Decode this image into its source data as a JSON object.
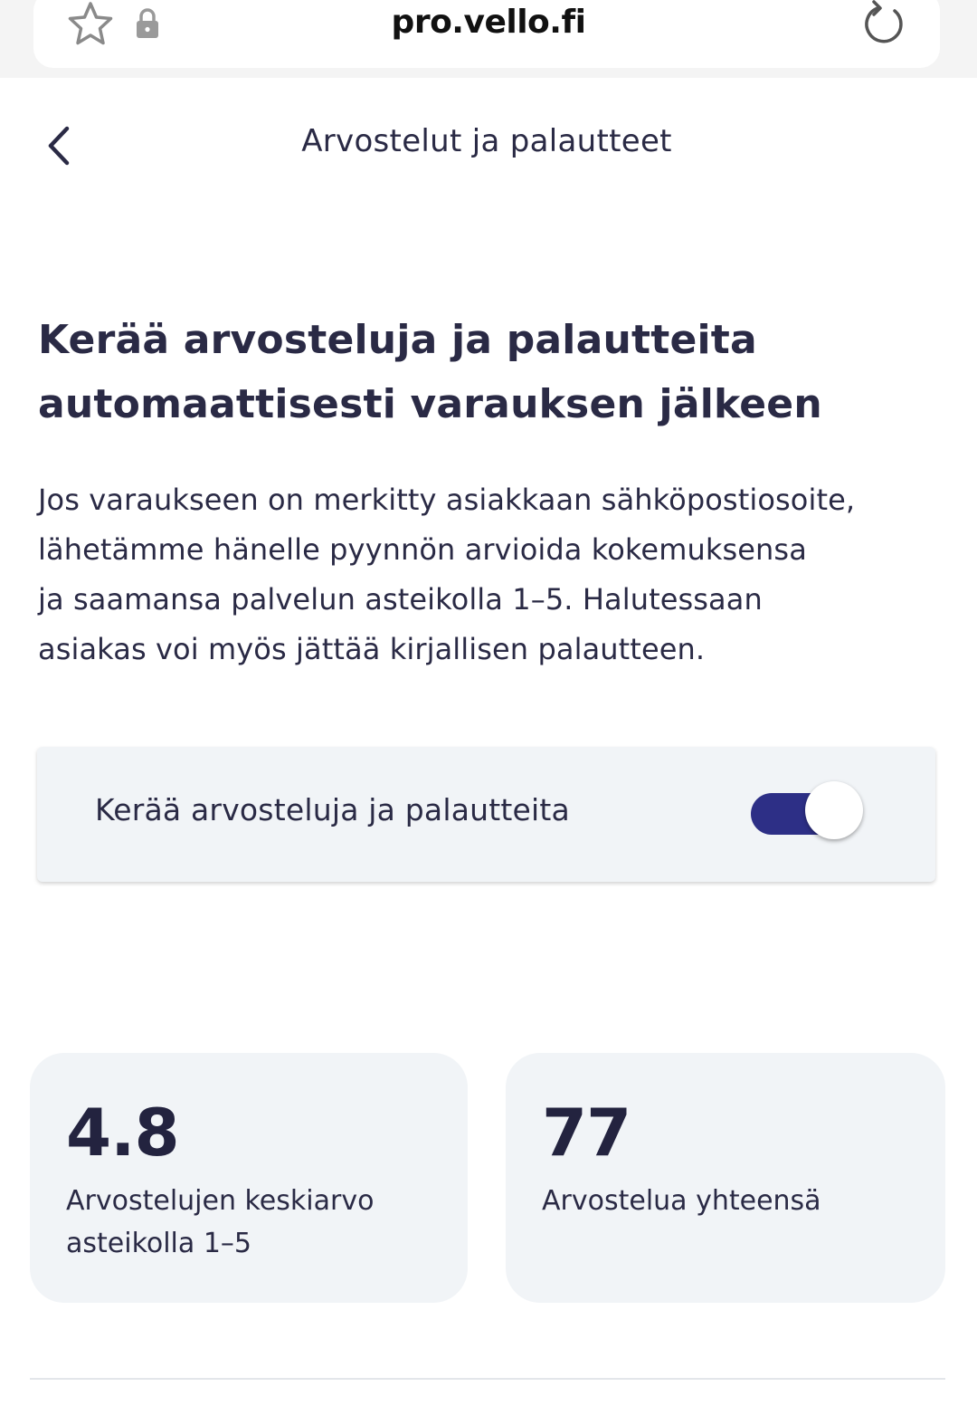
{
  "browser": {
    "url": "pro.vello.fi",
    "icons": [
      "star-icon",
      "lock-icon",
      "reload-icon"
    ]
  },
  "header": {
    "title": "Arvostelut ja palautteet",
    "back_icon": "chevron-left-icon"
  },
  "intro": {
    "headline_line1": "Kerää arvosteluja ja palautteita",
    "headline_line2": "automaattisesti varauksen jälkeen",
    "description_lines": [
      "Jos varaukseen on merkitty asiakkaan sähköpostiosoite,",
      "lähetämme hänelle pyynnön arvioida kokemuksensa",
      "ja saamansa palvelun asteikolla 1–5. Halutessaan",
      "asiakas voi myös jättää kirjallisen palautteen."
    ]
  },
  "settings": {
    "collect_reviews_label": "Kerää arvosteluja ja palautteita",
    "collect_reviews_enabled": true
  },
  "stats": {
    "average": {
      "value": "4.8",
      "label_line1": "Arvostelujen keskiarvo",
      "label_line2": "asteikolla 1–5"
    },
    "total": {
      "value": "77",
      "label_line1": "Arvostelua yhteensä"
    }
  },
  "colors": {
    "accent": "#2d2f86",
    "text": "#2a2a45",
    "card_bg": "#f1f4f7"
  }
}
